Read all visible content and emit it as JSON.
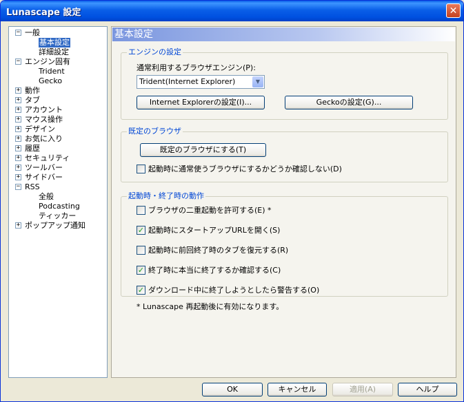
{
  "window": {
    "title": "Lunascape 設定",
    "close_label": "✕"
  },
  "tree": [
    {
      "label": "一般",
      "level": 0,
      "expander": "−"
    },
    {
      "label": "基本設定",
      "level": 1,
      "selected": true
    },
    {
      "label": "詳細設定",
      "level": 1
    },
    {
      "label": "エンジン固有",
      "level": 0,
      "expander": "−"
    },
    {
      "label": "Trident",
      "level": 1
    },
    {
      "label": "Gecko",
      "level": 1
    },
    {
      "label": "動作",
      "level": 0,
      "expander": "+"
    },
    {
      "label": "タブ",
      "level": 0,
      "expander": "+"
    },
    {
      "label": "アカウント",
      "level": 0,
      "expander": "+"
    },
    {
      "label": "マウス操作",
      "level": 0,
      "expander": "+"
    },
    {
      "label": "デザイン",
      "level": 0,
      "expander": "+"
    },
    {
      "label": "お気に入り",
      "level": 0,
      "expander": "+"
    },
    {
      "label": "履歴",
      "level": 0,
      "expander": "+"
    },
    {
      "label": "セキュリティ",
      "level": 0,
      "expander": "+"
    },
    {
      "label": "ツールバー",
      "level": 0,
      "expander": "+"
    },
    {
      "label": "サイドバー",
      "level": 0,
      "expander": "+"
    },
    {
      "label": "RSS",
      "level": 0,
      "expander": "−"
    },
    {
      "label": "全般",
      "level": 1
    },
    {
      "label": "Podcasting",
      "level": 1
    },
    {
      "label": "ティッカー",
      "level": 1
    },
    {
      "label": "ポップアップ通知",
      "level": 0,
      "expander": "+"
    }
  ],
  "content": {
    "header": "基本設定",
    "engine": {
      "title": "エンジンの設定",
      "select_label": "通常利用するブラウザエンジン(P):",
      "select_value": "Trident(Internet Explorer)",
      "ie_button": "Internet Explorerの設定(I)...",
      "gecko_button": "Geckoの設定(G)..."
    },
    "default_browser": {
      "title": "既定のブラウザ",
      "button": "既定のブラウザにする(T)",
      "checkbox": "起動時に通常使うブラウザにするかどうか確認しない(D)",
      "checked": false
    },
    "startup": {
      "title": "起動時・終了時の動作",
      "options": [
        {
          "label": "ブラウザの二重起動を許可する(E) *",
          "checked": false
        },
        {
          "label": "起動時にスタートアップURLを開く(S)",
          "checked": true
        },
        {
          "label": "起動時に前回終了時のタブを復元する(R)",
          "checked": false
        },
        {
          "label": "終了時に本当に終了するか確認する(C)",
          "checked": true
        },
        {
          "label": "ダウンロード中に終了しようとしたら警告する(O)",
          "checked": true
        }
      ]
    },
    "note": "* Lunascape 再起動後に有効になります。"
  },
  "footer": {
    "ok": "OK",
    "cancel": "キャンセル",
    "apply": "適用(A)",
    "help": "ヘルプ"
  },
  "check_mark": "✓"
}
